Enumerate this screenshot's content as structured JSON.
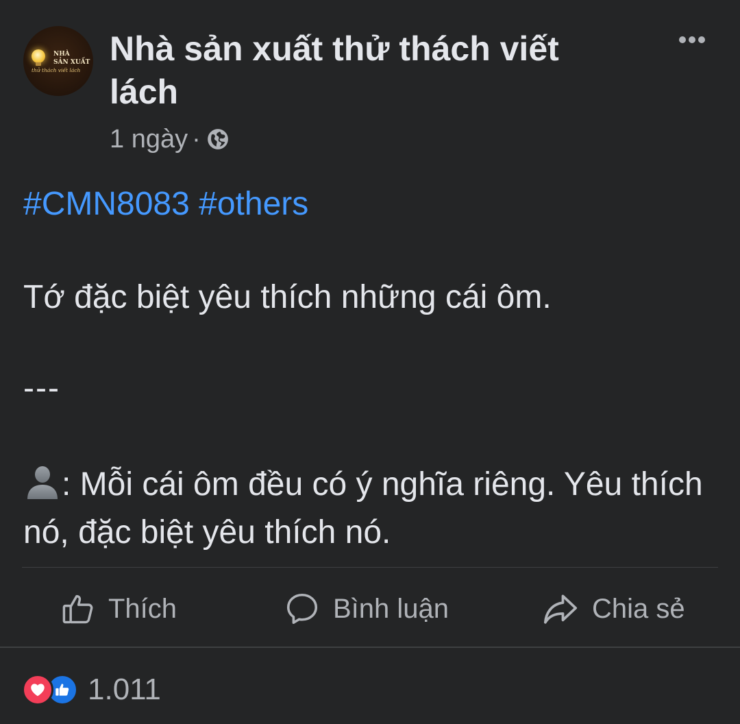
{
  "post": {
    "page_name": "Nhà sản xuất thử thách viết lách",
    "avatar": {
      "logo_line1": "NHÀ",
      "logo_line2": "SẢN XUẤT",
      "logo_line3": "thử thách viết lách"
    },
    "timestamp": "1 ngày",
    "meta_separator": "·",
    "privacy_icon": "globe-icon",
    "more_icon": "more-horizontal-icon",
    "hashtags": [
      "#CMN8083",
      "#others"
    ],
    "body_line1": "Tớ đặc biệt yêu thích những cái ôm.",
    "separator": "---",
    "quote_icon": "person-silhouette-icon",
    "quote_text": ": Mỗi cái ôm đều có ý nghĩa riêng. Yêu thích nó, đặc biệt yêu thích nó."
  },
  "actions": {
    "like_label": "Thích",
    "comment_label": "Bình luận",
    "share_label": "Chia sẻ"
  },
  "reactions": {
    "types": [
      "love",
      "like"
    ],
    "count": "1.011"
  },
  "colors": {
    "background": "#242526",
    "text_primary": "#e4e6eb",
    "text_secondary": "#b0b3b8",
    "link": "#4599ff",
    "love": "#f33e58",
    "like": "#1b74e4"
  }
}
